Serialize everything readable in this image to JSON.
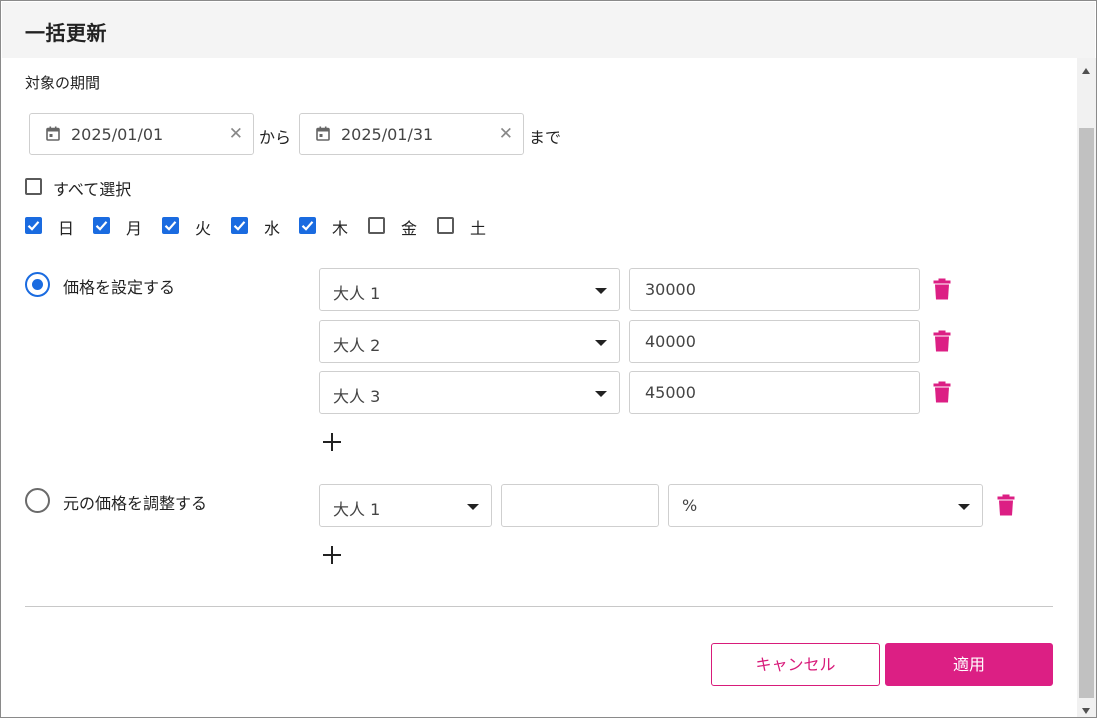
{
  "dialog": {
    "title": "一括更新"
  },
  "period": {
    "label": "対象の期間",
    "start_date": "2025/01/01",
    "from_text": "から",
    "end_date": "2025/01/31",
    "until_text": "まで"
  },
  "select_all": {
    "label": "すべて選択",
    "checked": false
  },
  "weekdays": [
    {
      "label": "日",
      "checked": true
    },
    {
      "label": "月",
      "checked": true
    },
    {
      "label": "火",
      "checked": true
    },
    {
      "label": "水",
      "checked": true
    },
    {
      "label": "木",
      "checked": true
    },
    {
      "label": "金",
      "checked": false
    },
    {
      "label": "土",
      "checked": false
    }
  ],
  "set_price": {
    "label": "価格を設定する",
    "selected": true,
    "rows": [
      {
        "category": "大人 1",
        "price": "30000"
      },
      {
        "category": "大人 2",
        "price": "40000"
      },
      {
        "category": "大人 3",
        "price": "45000"
      }
    ]
  },
  "adjust_price": {
    "label": "元の価格を調整する",
    "selected": false,
    "rows": [
      {
        "category": "大人 1",
        "amount": "",
        "unit": "%"
      }
    ]
  },
  "buttons": {
    "cancel": "キャンセル",
    "apply": "適用"
  },
  "colors": {
    "accent": "#dc1f84",
    "checkbox": "#1a6be0",
    "header_bg": "#f4f4f4"
  },
  "icons": [
    "calendar-icon",
    "clear-icon",
    "trash-icon",
    "plus-icon",
    "chevron-down-icon"
  ]
}
